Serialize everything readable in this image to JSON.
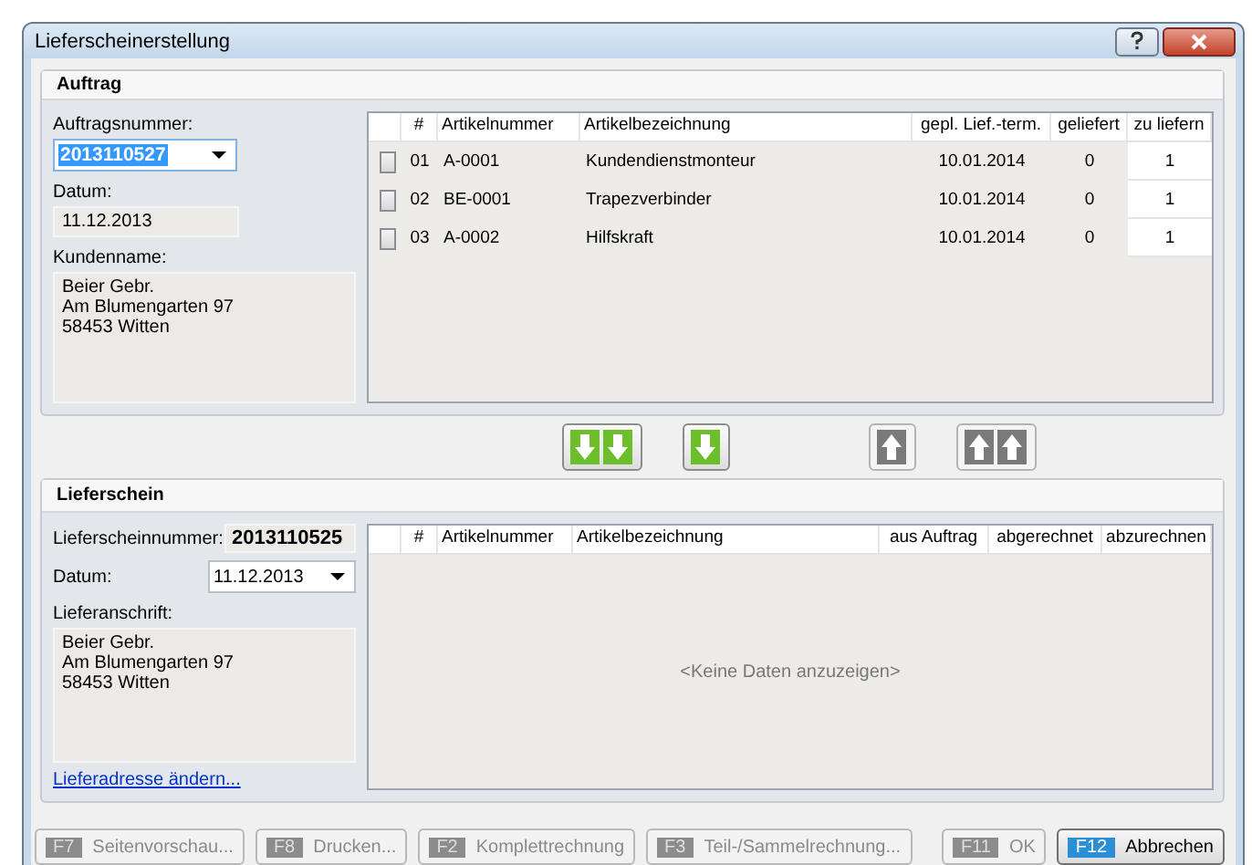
{
  "window": {
    "title": "Lieferscheinerstellung"
  },
  "order": {
    "title": "Auftrag",
    "number_label": "Auftragsnummer:",
    "number": "2013110527",
    "date_label": "Datum:",
    "date": "11.12.2013",
    "customer_label": "Kundenname:",
    "customer": [
      "Beier Gebr.",
      "Am Blumengarten 97",
      "58453 Witten"
    ],
    "table": {
      "columns": [
        "#",
        "Artikelnummer",
        "Artikelbezeichnung",
        "gepl. Lief.-term.",
        "geliefert",
        "zu liefern"
      ],
      "rows": [
        {
          "checked": false,
          "cells": [
            "01",
            "A-0001",
            "Kundendienstmonteur",
            "10.01.2014",
            "0",
            "1"
          ]
        },
        {
          "checked": false,
          "cells": [
            "02",
            "BE-0001",
            "Trapezverbinder",
            "10.01.2014",
            "0",
            "1"
          ]
        },
        {
          "checked": false,
          "cells": [
            "03",
            "A-0002",
            "Hilfskraft",
            "10.01.2014",
            "0",
            "1"
          ]
        }
      ]
    }
  },
  "transfer_buttons": [
    {
      "kind": "all_down",
      "disabled": false
    },
    {
      "kind": "down",
      "disabled": false
    },
    {
      "kind": "up",
      "disabled": true
    },
    {
      "kind": "all_up",
      "disabled": true
    }
  ],
  "delivery": {
    "title": "Lieferschein",
    "number_label": "Lieferscheinnummer:",
    "number": "2013110525",
    "date_label": "Datum:",
    "date": "11.12.2013",
    "address_label": "Lieferanschrift:",
    "address": [
      "Beier Gebr.",
      "Am Blumengarten 97",
      "58453 Witten"
    ],
    "link": "Lieferadresse ändern...",
    "table": {
      "columns": [
        "#",
        "Artikelnummer",
        "Artikelbezeichnung",
        "aus Auftrag",
        "abgerechnet",
        "abzurechnen"
      ],
      "empty": "<Keine Daten anzuzeigen>"
    }
  },
  "buttons": [
    {
      "key": "F7",
      "label": "Seitenvorschau...",
      "disabled": true
    },
    {
      "key": "F8",
      "label": "Drucken...",
      "disabled": true
    },
    {
      "key": "F2",
      "label": "Komplettrechnung",
      "disabled": true
    },
    {
      "key": "F3",
      "label": "Teil-/Sammelrechnung...",
      "disabled": true
    },
    {
      "key": "F11",
      "label": "OK",
      "disabled": true
    },
    {
      "key": "F12",
      "label": "Abbrechen",
      "disabled": false
    }
  ]
}
